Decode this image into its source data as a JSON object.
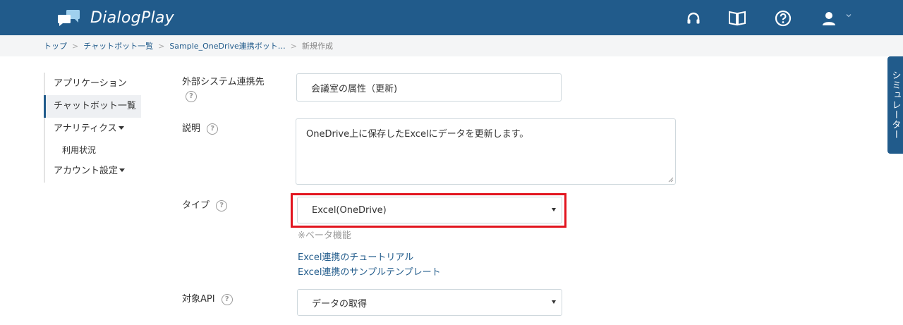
{
  "app": {
    "title": "DialogPlay",
    "brand_color": "#215b8b",
    "header_icons": [
      "headset-icon",
      "book-icon",
      "help-circle-icon",
      "user-icon"
    ]
  },
  "breadcrumb": {
    "items": [
      "トップ",
      "チャットボット一覧",
      "Sample_OneDrive連携ボット…"
    ],
    "current": "新規作成",
    "separator": ">"
  },
  "sidebar": {
    "items": [
      {
        "label": "アプリケーション"
      },
      {
        "label": "チャットボット一覧",
        "active": true
      },
      {
        "label": "アナリティクス"
      },
      {
        "label": "利用状況"
      },
      {
        "label": "アカウント設定"
      }
    ]
  },
  "form": {
    "external_system": {
      "label": "外部システム連携先",
      "value": "会議室の属性（更新)"
    },
    "description": {
      "label": "説明",
      "value": "OneDrive上に保存したExcelにデータを更新します。"
    },
    "type": {
      "label": "タイプ",
      "value": "Excel(OneDrive)",
      "note": "※ベータ機能",
      "highlight_color": "#e2151f"
    },
    "links": [
      "Excel連携のチュートリアル",
      "Excel連携のサンプルテンプレート"
    ],
    "target_api": {
      "label": "対象API",
      "value": "データの取得"
    },
    "help_symbol": "?"
  },
  "simulator": {
    "label": "シミュレーター"
  }
}
